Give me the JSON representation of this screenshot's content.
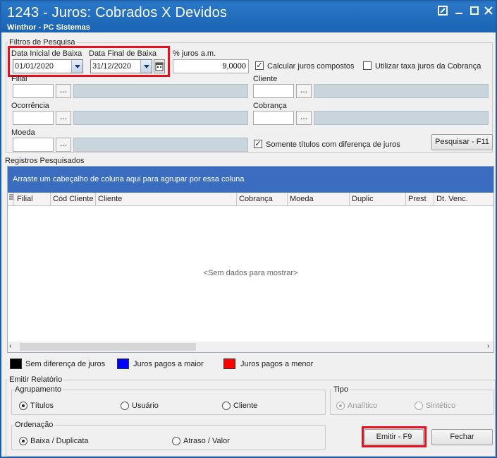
{
  "window": {
    "title": "1243 - Juros: Cobrados  X  Devidos",
    "subtitle": "Winthor - PC Sistemas"
  },
  "filters": {
    "legend": "Filtros de Pesquisa",
    "data_inicial_label": "Data Inicial de Baixa",
    "data_inicial_value": "01/01/2020",
    "data_final_label": "Data Final de Baixa",
    "data_final_value": "31/12/2020",
    "juros_label": "% juros a.m.",
    "juros_value": "9,0000",
    "calcular_compostos_label": "Calcular juros compostos",
    "calcular_compostos_checked": true,
    "utilizar_taxa_label": "Utilizar taxa juros da Cobrança",
    "utilizar_taxa_checked": false,
    "filial_label": "Filial",
    "cliente_label": "Cliente",
    "ocorrencia_label": "Ocorrência",
    "cobranca_label": "Cobrança",
    "moeda_label": "Moeda",
    "somente_label": "Somente títulos com diferença de juros",
    "somente_checked": true,
    "lookup_button": "...",
    "pesquisar_button": "Pesquisar - F11"
  },
  "results": {
    "legend": "Registros Pesquisados",
    "group_hint": "Arraste um cabeçalho de coluna aqui para agrupar por essa coluna",
    "columns": [
      "Filial",
      "Cód Cliente",
      "Cliente",
      "Cobrança",
      "Moeda",
      "Duplic",
      "Prest",
      "Dt. Venc."
    ],
    "empty_text": "<Sem dados para mostrar>"
  },
  "color_legend": [
    {
      "label": "Sem diferença de juros",
      "color": "#000000"
    },
    {
      "label": "Juros pagos a maior",
      "color": "#0000ff"
    },
    {
      "label": "Juros pagos a menor",
      "color": "#ff0000"
    }
  ],
  "report": {
    "legend": "Emitir Relatório",
    "agrupamento_legend": "Agrupamento",
    "agrupamento_options": [
      "Títulos",
      "Usuário",
      "Cliente"
    ],
    "agrupamento_selected": "Títulos",
    "tipo_legend": "Tipo",
    "tipo_options": [
      "Analítico",
      "Sintético"
    ],
    "tipo_selected": "Analítico",
    "ordenacao_legend": "Ordenação",
    "ordenacao_options": [
      "Baixa / Duplicata",
      "Atraso / Valor"
    ],
    "ordenacao_selected": "Baixa / Duplicata",
    "emitir_button": "Emitir - F9",
    "fechar_button": "Fechar"
  },
  "colors": {
    "titlebar": "#1b63b3",
    "highlight": "#e8101f",
    "grid_group_bar": "#3a6cbf",
    "readonly_field": "#c9d4dc"
  }
}
